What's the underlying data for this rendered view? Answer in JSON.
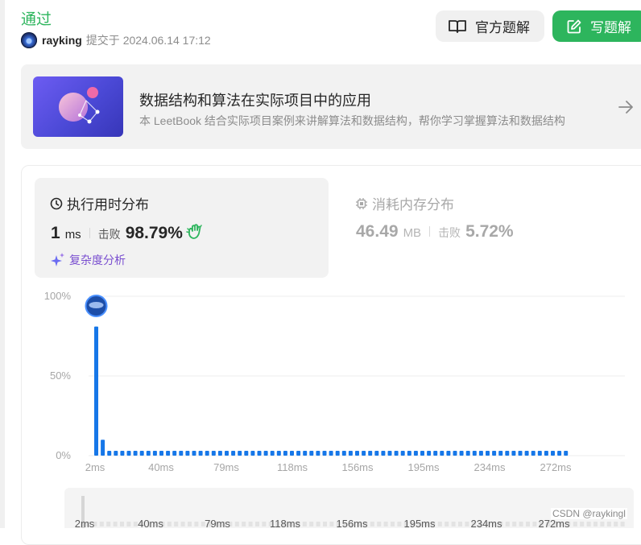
{
  "submission": {
    "status": "通过",
    "username": "rayking",
    "submitted_label": "提交于 2024.06.14 17:12"
  },
  "buttons": {
    "official_solution": "官方题解",
    "write_solution": "写题解"
  },
  "banner": {
    "title": "数据结构和算法在实际项目中的应用",
    "subtitle": "本 LeetBook 结合实际项目案例来讲解算法和数据结构，帮你学习掌握算法和数据结构"
  },
  "runtime": {
    "title": "执行用时分布",
    "value": "1",
    "unit": "ms",
    "beat_label": "击败",
    "beat_value": "98.79%",
    "complexity_link": "复杂度分析"
  },
  "memory": {
    "title": "消耗内存分布",
    "value": "46.49",
    "unit": "MB",
    "beat_label": "击败",
    "beat_value": "5.72%"
  },
  "colors": {
    "accent_green": "#2db55d",
    "bar_blue": "#1677e8",
    "complexity_purple": "#7a4fd0"
  },
  "chart_data": {
    "type": "bar",
    "title": "",
    "xlabel": "",
    "ylabel": "",
    "ylim": [
      0,
      100
    ],
    "y_ticks": [
      "0%",
      "50%",
      "100%"
    ],
    "x_tick_labels": [
      "2ms",
      "40ms",
      "79ms",
      "118ms",
      "156ms",
      "195ms",
      "234ms",
      "272ms"
    ],
    "highlighted_index": 0,
    "series": [
      {
        "values": [
          81,
          10,
          3,
          3,
          3,
          3,
          3,
          3,
          3,
          3,
          3,
          3,
          3,
          3,
          3,
          3,
          3,
          3,
          3,
          3,
          3,
          3,
          3,
          3,
          3,
          3,
          3,
          3,
          3,
          3,
          3,
          3,
          3,
          3,
          3,
          3,
          3,
          3,
          3,
          3,
          3,
          3,
          3,
          3,
          3,
          3,
          3,
          3,
          3,
          3,
          3,
          3,
          3,
          3,
          3,
          3,
          3,
          3,
          3,
          3,
          3,
          3,
          3,
          3,
          3,
          3,
          3,
          3,
          3,
          3,
          3,
          3,
          3
        ]
      }
    ],
    "grid": true
  },
  "navigator": {
    "tick_labels": [
      "2ms",
      "40ms",
      "79ms",
      "118ms",
      "156ms",
      "195ms",
      "234ms",
      "272ms"
    ]
  },
  "watermark": "CSDN @raykingl"
}
